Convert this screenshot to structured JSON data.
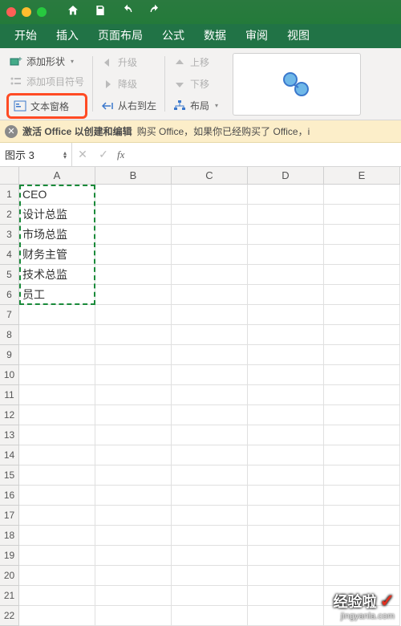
{
  "traffic": {
    "close": "close",
    "min": "minimize",
    "max": "maximize"
  },
  "titlebar_icons": [
    "home",
    "save",
    "undo",
    "redo"
  ],
  "tabs": [
    "开始",
    "插入",
    "页面布局",
    "公式",
    "数据",
    "审阅",
    "视图"
  ],
  "ribbon": {
    "addshape": "添加形状",
    "addbullet": "添加项目符号",
    "textpane": "文本窗格",
    "promote": "升级",
    "demote": "降级",
    "rtl": "从右到左",
    "moveup": "上移",
    "movedown": "下移",
    "layout": "布局"
  },
  "banner": {
    "bold": "激活 Office 以创建和编辑",
    "rest": "购买 Office，如果你已经购买了 Office，i"
  },
  "namebox": "图示 3",
  "fx_label": "fx",
  "columns": [
    "A",
    "B",
    "C",
    "D",
    "E"
  ],
  "rows": [
    1,
    2,
    3,
    4,
    5,
    6,
    7,
    8,
    9,
    10,
    11,
    12,
    13,
    14,
    15,
    16,
    17,
    18,
    19,
    20,
    21,
    22
  ],
  "cells": {
    "A1": "CEO",
    "A2": "设计总监",
    "A3": "市场总监",
    "A4": "财务主管",
    "A5": "技术总监",
    "A6": "员工"
  },
  "watermark": {
    "line1": "经验啦",
    "line2": "jingyanla.com"
  }
}
